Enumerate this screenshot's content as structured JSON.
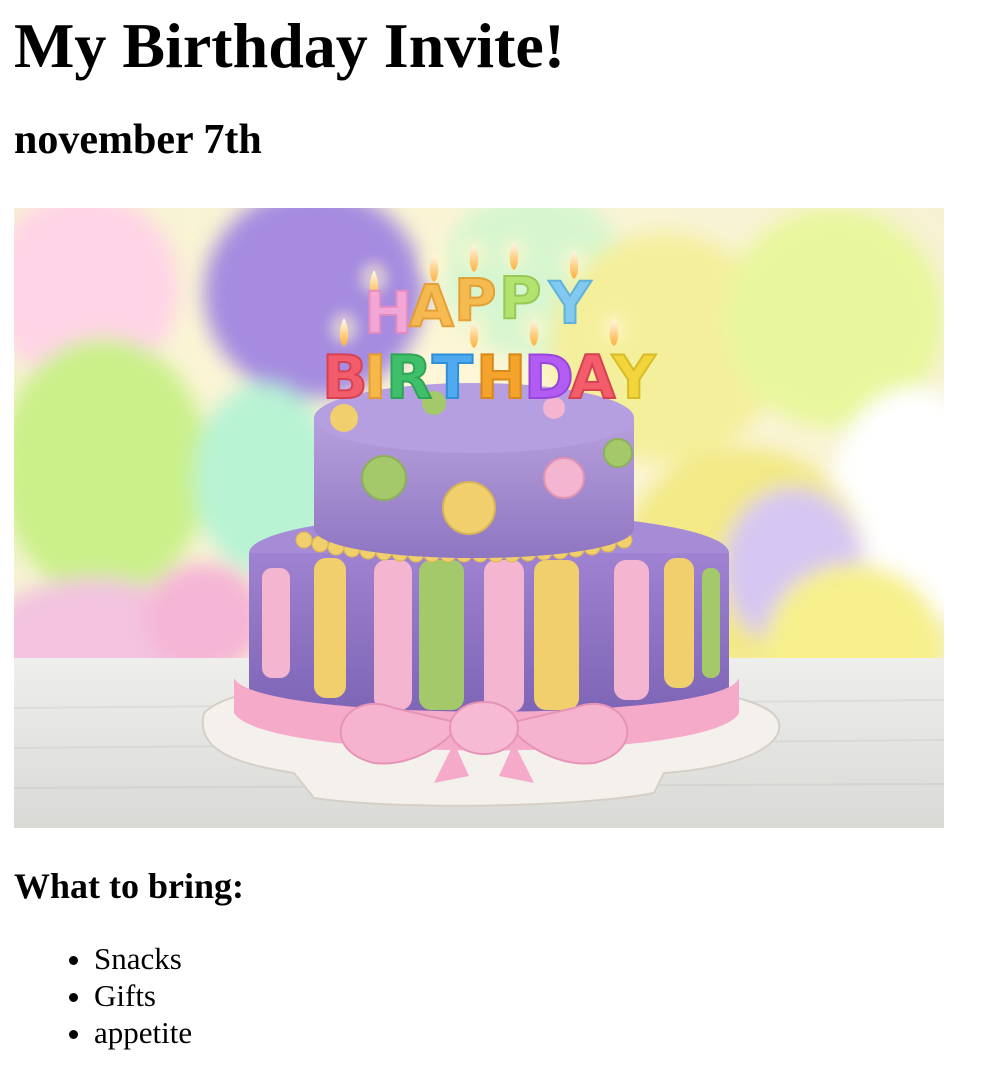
{
  "title": "My Birthday Invite!",
  "date": "november 7th",
  "image": {
    "alt": "Birthday cake",
    "cake_topper_text": "HAPPY BIRTHDAY",
    "colors": {
      "purple": "#9a7fc9",
      "pink": "#f4b6d0",
      "yellow": "#f2cf6a",
      "green": "#a9c96b",
      "board": "#f1eeea"
    }
  },
  "bring": {
    "heading": "What to bring:",
    "items": [
      "Snacks",
      "Gifts",
      "appetite"
    ]
  }
}
